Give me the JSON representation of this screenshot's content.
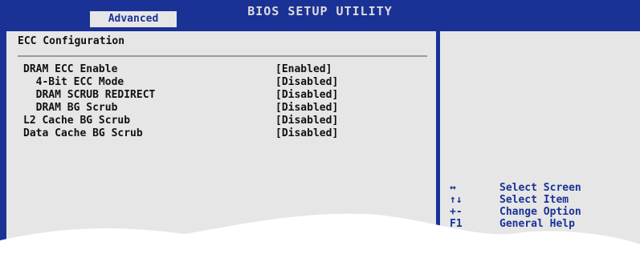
{
  "header": {
    "title": "BIOS SETUP UTILITY",
    "active_tab": "Advanced"
  },
  "main": {
    "section_title": "ECC Configuration",
    "items": [
      {
        "label": "DRAM ECC Enable",
        "value": "[Enabled]"
      },
      {
        "label": "  4-Bit ECC Mode",
        "value": "[Disabled]"
      },
      {
        "label": "  DRAM SCRUB REDIRECT",
        "value": "[Disabled]"
      },
      {
        "label": "  DRAM BG Scrub",
        "value": "[Disabled]"
      },
      {
        "label": "L2 Cache BG Scrub",
        "value": "[Disabled]"
      },
      {
        "label": "Data Cache BG Scrub",
        "value": "[Disabled]"
      }
    ]
  },
  "help": {
    "keys": [
      {
        "key": "↔",
        "desc": "Select Screen"
      },
      {
        "key": "↑↓",
        "desc": "Select Item"
      },
      {
        "key": "+-",
        "desc": "Change Option"
      },
      {
        "key": "F1",
        "desc": "General Help"
      }
    ]
  },
  "colors": {
    "background": "#1a3296",
    "panel": "#e6e6e6",
    "text": "#111111",
    "help_text": "#1a3296"
  }
}
